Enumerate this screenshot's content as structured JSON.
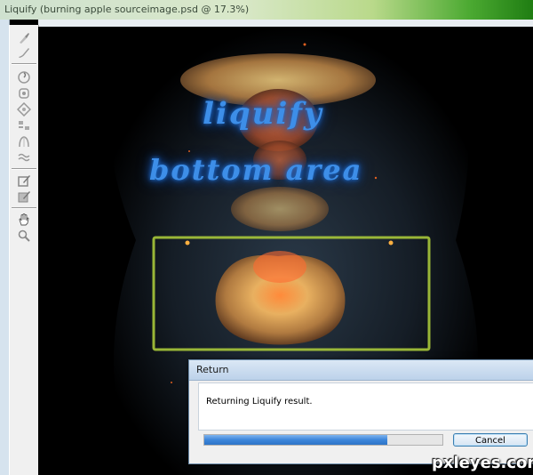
{
  "window": {
    "title": "Liquify (burning apple sourceimage.psd @ 17.3%)"
  },
  "toolbar": {
    "tools": [
      {
        "name": "forward-warp-tool",
        "icon": "warp-brush-icon"
      },
      {
        "name": "reconstruct-tool",
        "icon": "reconstruct-brush-icon"
      },
      {
        "name": "twirl-clockwise-tool",
        "icon": "twirl-icon"
      },
      {
        "name": "pucker-tool",
        "icon": "pucker-icon"
      },
      {
        "name": "bloat-tool",
        "icon": "bloat-icon"
      },
      {
        "name": "push-left-tool",
        "icon": "push-left-icon"
      },
      {
        "name": "mirror-tool",
        "icon": "mirror-icon"
      },
      {
        "name": "turbulence-tool",
        "icon": "turbulence-icon"
      },
      {
        "name": "freeze-mask-tool",
        "icon": "freeze-mask-icon"
      },
      {
        "name": "thaw-mask-tool",
        "icon": "thaw-mask-icon"
      },
      {
        "name": "hand-tool",
        "icon": "hand-icon"
      },
      {
        "name": "zoom-tool",
        "icon": "zoom-icon"
      }
    ]
  },
  "canvas": {
    "art_line1": "liquify",
    "art_line2": "bottom area",
    "highlight_color": "#a8c83a"
  },
  "dialog": {
    "title": "Return",
    "message": "Returning Liquify result.",
    "progress": 0.77,
    "cancel_label": "Cancel"
  },
  "watermark": "pxleyes.com"
}
